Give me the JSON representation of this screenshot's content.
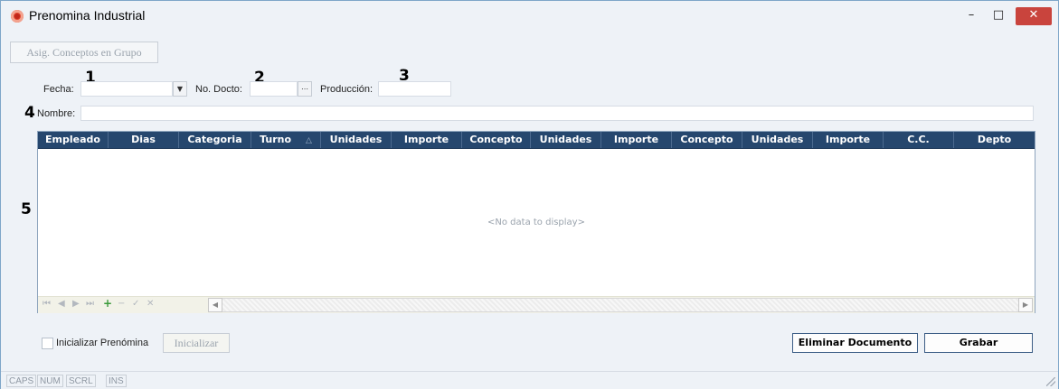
{
  "window": {
    "title": "Prenomina Industrial",
    "minimize": "–",
    "maximize": "□",
    "close": "✕"
  },
  "toolbar": {
    "asig_conceptos_label": "Asig. Conceptos en Grupo"
  },
  "annotations": [
    "1",
    "2",
    "3",
    "4",
    "5"
  ],
  "form": {
    "fecha_label": "Fecha:",
    "fecha_value": "",
    "no_docto_label": "No. Docto:",
    "no_docto_value": "",
    "produccion_label": "Producción:",
    "produccion_value": "",
    "nombre_label": "Nombre:",
    "nombre_value": ""
  },
  "grid": {
    "columns": [
      "Empleado",
      "Dias",
      "Categoria",
      "Turno",
      "Unidades",
      "Importe",
      "Concepto",
      "Unidades",
      "Importe",
      "Concepto",
      "Unidades",
      "Importe",
      "C.C.",
      "Depto"
    ],
    "sort_indicator": "△",
    "no_data_text": "<No data to display>",
    "navigator": [
      "⏮",
      "◀",
      "▶",
      "⏭",
      "+",
      "−",
      "✓",
      "✕"
    ]
  },
  "bottom": {
    "inicializar_checkbox_label": "Inicializar Prenómina",
    "inicializar_checked": false,
    "inicializar_button_label": "Inicializar",
    "eliminar_button_label": "Eliminar Documento",
    "grabar_button_label": "Grabar"
  },
  "status": [
    "CAPS",
    "NUM",
    "SCRL",
    "INS"
  ],
  "colors": {
    "grid_header_bg": "#26476e",
    "close_button_bg": "#c9443d"
  }
}
